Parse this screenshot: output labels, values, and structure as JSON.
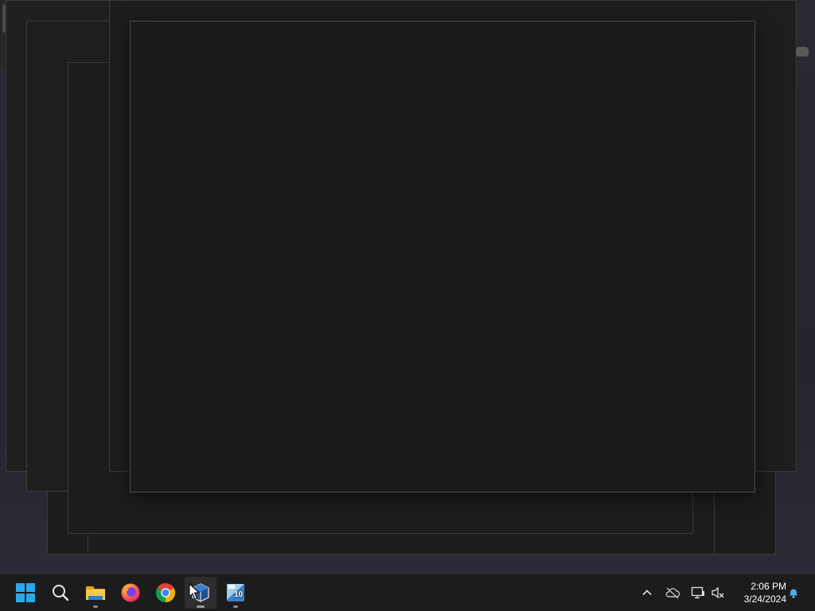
{
  "taskbar": {
    "apps": [
      {
        "name": "Start",
        "icon": "windows-logo-icon",
        "running": false
      },
      {
        "name": "Search",
        "icon": "search-icon",
        "running": false
      },
      {
        "name": "File Explorer",
        "icon": "folder-icon",
        "running": true
      },
      {
        "name": "Firefox",
        "icon": "firefox-icon",
        "running": false
      },
      {
        "name": "Chrome",
        "icon": "chrome-icon",
        "running": false
      },
      {
        "name": "VirtualBox",
        "icon": "virtualbox-icon",
        "running": true,
        "active": true
      },
      {
        "name": "CAD 10",
        "icon": "cad-app-icon",
        "badge": "10",
        "running": true
      }
    ],
    "tray": {
      "icons": [
        "chevron-up-icon",
        "cloud-offline-icon",
        "network-icon",
        "speaker-muted-icon",
        "notification-bell-icon"
      ],
      "time": "2:06 PM",
      "date": "3/24/2024"
    }
  },
  "colors": {
    "accent_windows": "#29a9e8",
    "taskbar_bg": "#1c1c1c",
    "window_bg": "#1b1b1c"
  }
}
